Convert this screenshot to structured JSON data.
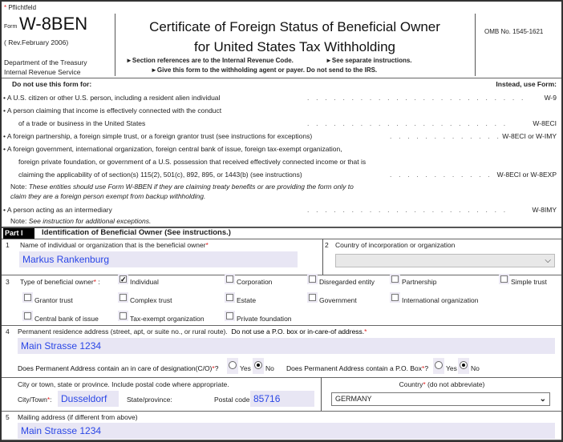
{
  "required_note": "Pflichtfeld",
  "header": {
    "form_word": "Form",
    "form_name": "W-8BEN",
    "revision": "( Rev.February 2006)",
    "dept1": "Department of the Treasury",
    "dept2": "Internal Revenue Service",
    "title1": "Certificate of Foreign Status of Beneficial Owner",
    "title2": "for United States Tax Withholding",
    "note1": "►Section references are to the Internal Revenue Code.",
    "note2": "►See separate instructions.",
    "note3": "►Give this form to the withholding agent or payer. Do not send to the IRS.",
    "omb": "OMB No. 1545-1621"
  },
  "exclusions": {
    "left_header": "Do not use this form for:",
    "right_header": "Instead, use Form:",
    "items": [
      {
        "lines": [
          "A U.S. citizen or other U.S. person, including a resident alien individual"
        ],
        "form": "W-9"
      },
      {
        "lines": [
          "A person claiming that income is effectively connected with the conduct",
          "of a trade or business in the United States"
        ],
        "form": "W-8ECI"
      },
      {
        "lines": [
          "A foreign partnership, a foreign simple trust, or a foreign grantor trust (see instructions for exceptions)"
        ],
        "form": "W-8ECI or W-IMY"
      },
      {
        "lines": [
          "A foreign government, international organization, foreign central bank of issue, foreign tax-exempt organization,",
          "foreign private foundation, or government of a U.S. possession that received effectively connected income or that is",
          "claiming the applicability of of section(s) 115(2), 501(c), 892, 895, or 1443(b) (see instructions)"
        ],
        "form": "W-8ECI or W-8EXP"
      },
      {
        "lines": [
          "A person acting as an intermediary"
        ],
        "form": "W-8IMY"
      }
    ],
    "note_label": "Note:",
    "note1a": "These entities should use Form W-8BEN if they are claiming treaty benefits or are providing the form only to",
    "note1b": "claim they are a foreign person exempt from backup withholding.",
    "note2": "See instruction for additional exceptions."
  },
  "part1": {
    "tag": "Part I",
    "title": "Identification of Beneficial Owner (See instructions.)",
    "f1_num": "1",
    "f1_label": "Name of individual or organization that is the beneficial owner",
    "f1_value": "Markus Rankenburg",
    "f2_num": "2",
    "f2_label": "Country of incorporation or organization",
    "f2_value": "",
    "f3_num": "3",
    "f3_label": "Type of beneficial owner",
    "f3_colon": " :",
    "owner_types": [
      {
        "label": "Individual",
        "checked": true
      },
      {
        "label": "Corporation",
        "checked": false
      },
      {
        "label": "Disregarded entity",
        "checked": false
      },
      {
        "label": "Partnership",
        "checked": false
      },
      {
        "label": "Simple trust",
        "checked": false
      },
      {
        "label": "Grantor trust",
        "checked": false
      },
      {
        "label": "Complex trust",
        "checked": false
      },
      {
        "label": "Estate",
        "checked": false
      },
      {
        "label": "Government",
        "checked": false
      },
      {
        "label": "International organization",
        "checked": false
      },
      {
        "label": "Central bank of issue",
        "checked": false
      },
      {
        "label": "Tax-exempt organization",
        "checked": false
      },
      {
        "label": "Private foundation",
        "checked": false
      }
    ],
    "f4_num": "4",
    "f4_label": "Permanent residence address (street, apt, or suite no., or rural route).",
    "f4_label_bold": "Do not use a P.O. box or in-care-of address.",
    "f4_value": "Main Strasse 1234",
    "q_co": "Does Permanent Address contain an in care of designation(C/O)",
    "q_co_answer": "No",
    "q_po": "Does Permanent Address contain a P.O. Box",
    "q_po_answer": "No",
    "yes": "Yes",
    "no": "No",
    "city_hint": "City or town, state or province. Include postal code where appropriate.",
    "city_label": "City/Town",
    "city_value": "Dusseldorf",
    "state_label": "State/province:",
    "state_value": "",
    "postal_label": "Postal code:",
    "postal_value": "85716",
    "country_label": "Country",
    "country_hint": " (do not abbreviate)",
    "country_value": "GERMANY",
    "f5_num": "5",
    "f5_label": "Mailing address (if different from above)",
    "f5_value": "Main Strasse 1234"
  }
}
